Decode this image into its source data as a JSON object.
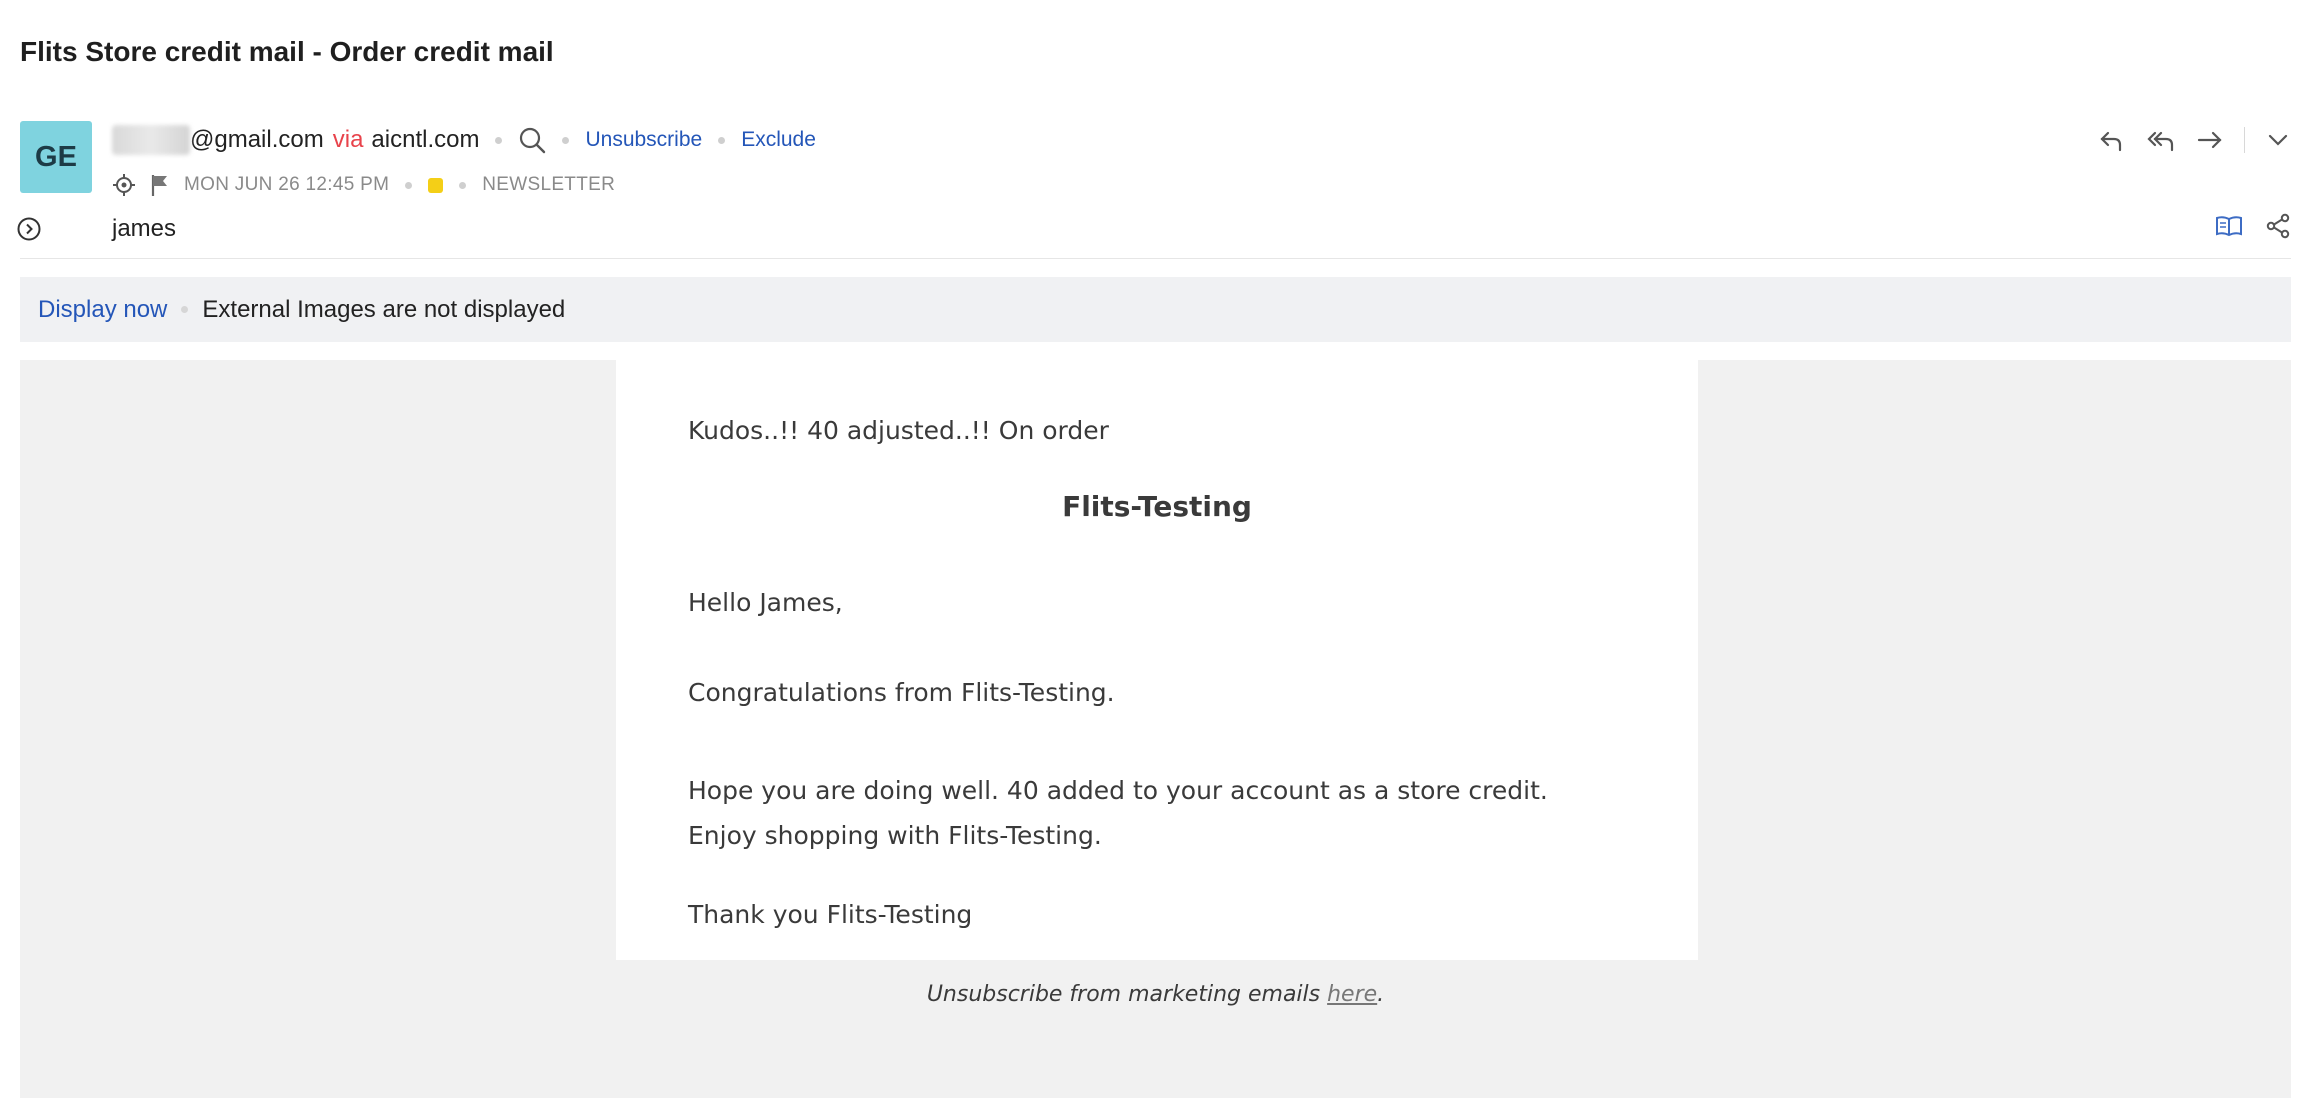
{
  "subject": "Flits Store credit mail - Order credit mail",
  "sender": {
    "avatar_initials": "GE",
    "email_domain": "@gmail.com",
    "via_label": "via",
    "via_domain": "aicntl.com",
    "unsubscribe_label": "Unsubscribe",
    "exclude_label": "Exclude"
  },
  "meta": {
    "date": "MON JUN 26 12:45 PM",
    "category": "NEWSLETTER",
    "tag_color": "#f4cf17"
  },
  "recipient": {
    "name": "james"
  },
  "image_banner": {
    "display_now": "Display now",
    "message": "External Images are not displayed"
  },
  "body": {
    "line1": "Kudos..!! 40 adjusted..!! On order",
    "brand": "Flits-Testing",
    "greeting": "Hello James,",
    "congrats": "Congratulations from Flits-Testing.",
    "message": "Hope you are doing well. 40 added to your account as a store credit. Enjoy shopping with Flits-Testing.",
    "closing": "Thank you Flits-Testing"
  },
  "footer": {
    "text": "Unsubscribe from marketing emails ",
    "link": "here",
    "end": "."
  },
  "icons": {
    "reply": "reply-icon",
    "reply_all": "reply-all-icon",
    "forward": "forward-icon",
    "more": "chevron-down-icon",
    "search": "search-icon",
    "location": "target-icon",
    "flag": "flag-icon",
    "expand": "expand-circle-icon",
    "reader": "book-icon",
    "share": "share-icon"
  },
  "colors": {
    "accent_link": "#2456b8",
    "via": "#e8434b",
    "avatar_bg": "#7fd3df"
  }
}
